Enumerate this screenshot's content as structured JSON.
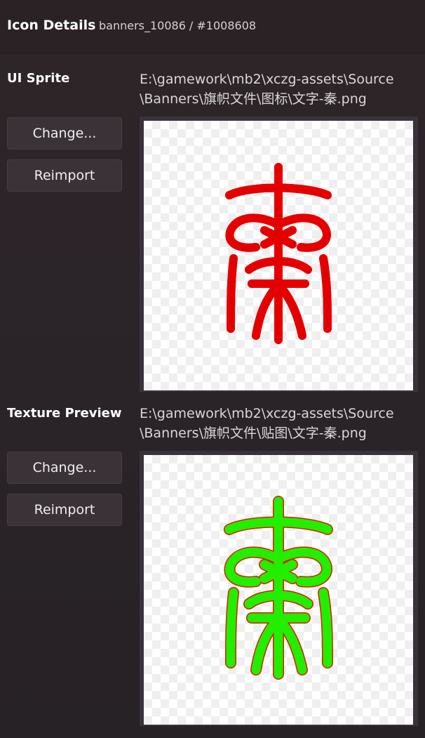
{
  "header": {
    "title": "Icon Details",
    "asset_name": "banners_10086",
    "asset_id": "/ #1008608"
  },
  "sections": [
    {
      "title": "UI Sprite",
      "path_line1": "E:\\gamework\\mb2\\xczg-assets\\Source",
      "path_line2": "\\Banners\\旗帜文件\\图标\\文字-秦.png",
      "change_label": "Change...",
      "reimport_label": "Reimport",
      "glyph_color": "#e50000",
      "glyph_outline": "#e50000"
    },
    {
      "title": "Texture Preview",
      "path_line1": "E:\\gamework\\mb2\\xczg-assets\\Source",
      "path_line2": "\\Banners\\旗帜文件\\贴图\\文字-秦.png",
      "change_label": "Change...",
      "reimport_label": "Reimport",
      "glyph_color": "#22ee00",
      "glyph_outline": "#e21a00"
    }
  ]
}
